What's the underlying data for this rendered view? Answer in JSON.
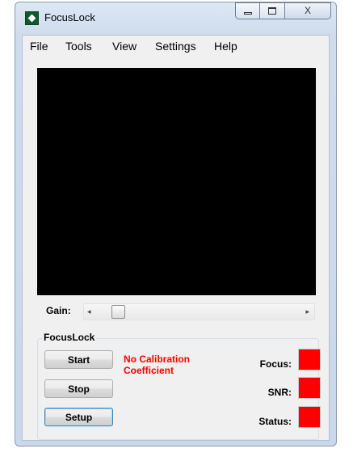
{
  "window": {
    "title": "FocusLock",
    "minimize_glyph": "",
    "maximize_glyph": "",
    "close_glyph": "X"
  },
  "menu": [
    "File",
    "Tools",
    "View",
    "Settings",
    "Help"
  ],
  "gain": {
    "label": "Gain:",
    "left_arrow": "◂",
    "right_arrow": "▸"
  },
  "group": {
    "title": "FocusLock",
    "buttons": {
      "start": "Start",
      "stop": "Stop",
      "setup": "Setup"
    },
    "warning": "No Calibration Coefficient",
    "indicators": {
      "focus": "Focus:",
      "snr": "SNR:",
      "status": "Status:"
    }
  },
  "colors": {
    "indicator": "#ff0000",
    "warning": "#ff0000",
    "display": "#000000"
  }
}
